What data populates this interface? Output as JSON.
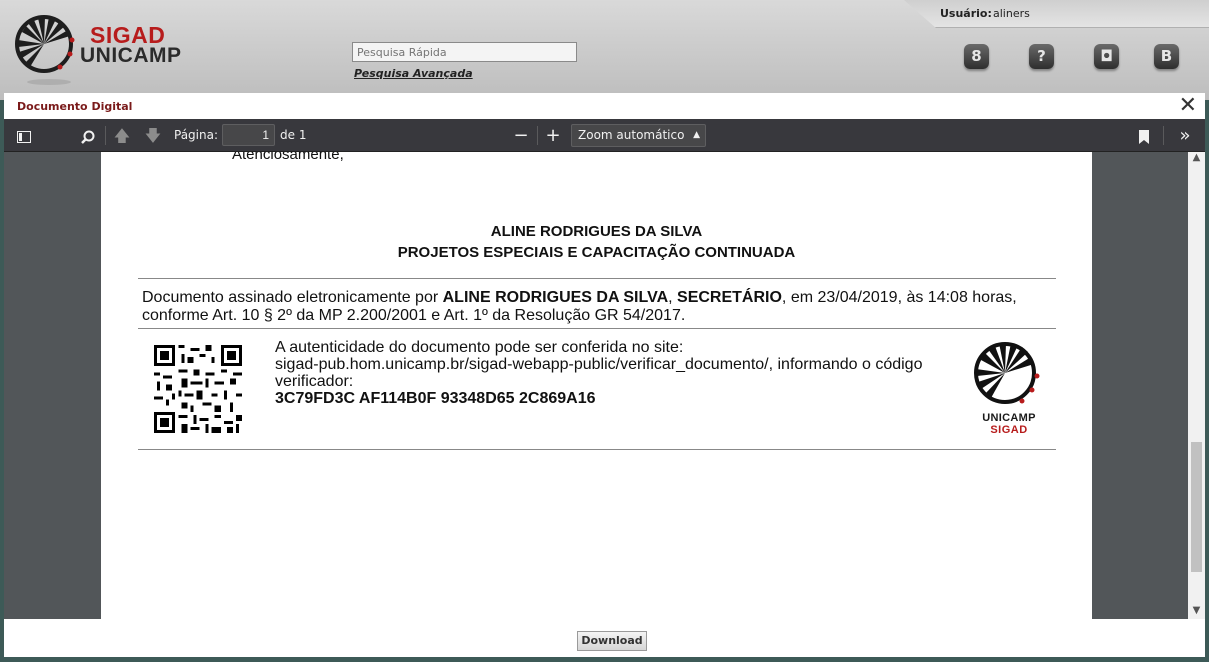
{
  "header": {
    "user_label": "Usuário:",
    "user_name": "aliners",
    "logo": {
      "top": "SIGAD",
      "bottom": "UNICAMP"
    },
    "quick_search_placeholder": "Pesquisa Rápida",
    "advanced_search_label": "Pesquisa Avançada",
    "buttons": [
      {
        "icon": "person-icon",
        "glyph": "8"
      },
      {
        "icon": "help-icon",
        "glyph": "?"
      },
      {
        "icon": "chat-icon",
        "glyph": "◘"
      },
      {
        "icon": "logout-icon",
        "glyph": "B"
      }
    ]
  },
  "modal": {
    "title": "Documento Digital",
    "close_glyph": "✕",
    "download_label": "Download"
  },
  "toolbar": {
    "page_label": "Página:",
    "page_value": "1",
    "page_total": "de 1",
    "zoom_value": "Zoom automático"
  },
  "document": {
    "closing": "Atenciosamente,",
    "signer_name": "ALINE RODRIGUES DA SILVA",
    "signer_dept": "PROJETOS ESPECIAIS E CAPACITAÇÃO CONTINUADA",
    "sig_prefix": "Documento assinado eletronicamente por ",
    "sig_name": "ALINE RODRIGUES DA SILVA",
    "sig_comma": ", ",
    "sig_role": "SECRETÁRIO",
    "sig_suffix": ", em 23/04/2019, às 14:08 horas, conforme Art. 10 § 2º da MP 2.200/2001 e Art. 1º da Resolução GR 54/2017.",
    "verify_line1": "A autenticidade do documento pode ser conferida no site:",
    "verify_line2": "sigad-pub.hom.unicamp.br/sigad-webapp-public/verificar_documento/, informando o código verificador:",
    "verify_code": "3C79FD3C AF114B0F 93348D65 2C869A16",
    "logo_unicamp": "UNICAMP",
    "logo_sigad": "SIGAD"
  }
}
